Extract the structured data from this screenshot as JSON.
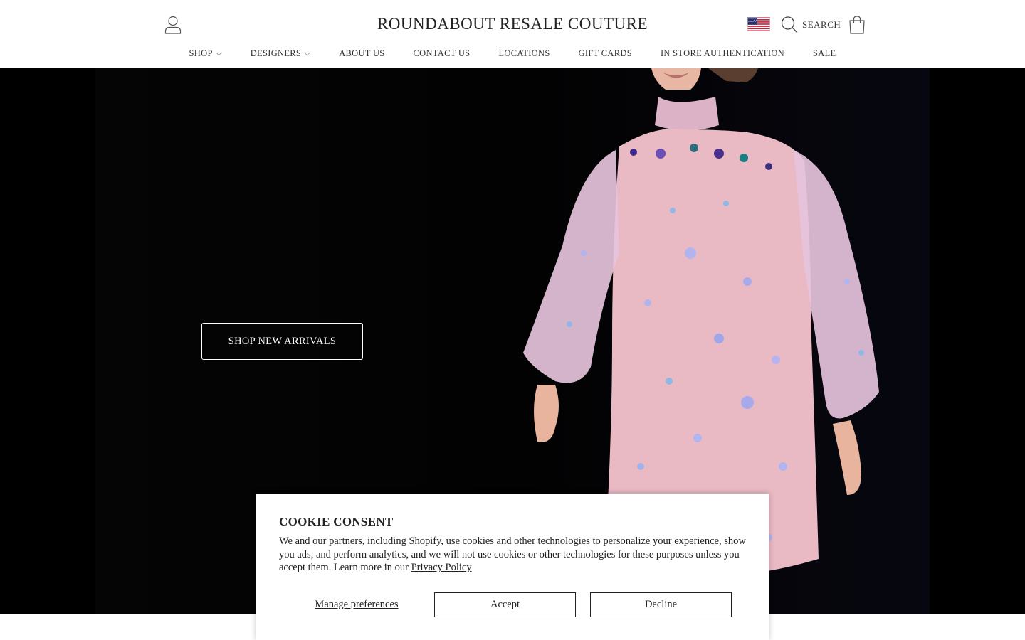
{
  "header": {
    "logo": "ROUNDABOUT RESALE COUTURE",
    "search_label": "SEARCH"
  },
  "nav": {
    "items": [
      {
        "label": "SHOP",
        "dropdown": true
      },
      {
        "label": "DESIGNERS",
        "dropdown": true
      },
      {
        "label": "ABOUT US",
        "dropdown": false
      },
      {
        "label": "CONTACT US",
        "dropdown": false
      },
      {
        "label": "LOCATIONS",
        "dropdown": false
      },
      {
        "label": "GIFT CARDS",
        "dropdown": false
      },
      {
        "label": "IN STORE AUTHENTICATION",
        "dropdown": false
      },
      {
        "label": "SALE",
        "dropdown": false
      }
    ]
  },
  "hero": {
    "cta_label": "SHOP NEW ARRIVALS"
  },
  "cookie": {
    "title": "COOKIE CONSENT",
    "body": "We and our partners, including Shopify, use cookies and other technologies to personalize your experience, show you ads, and perform analytics, and we will not use cookies or other technologies for these purposes unless you accept them. Learn more in our ",
    "link_label": "Privacy Policy",
    "manage_label": "Manage preferences",
    "accept_label": "Accept",
    "decline_label": "Decline"
  },
  "icons": {
    "account": "user-icon",
    "flag": "us-flag-icon",
    "search": "search-icon",
    "cart": "shopping-bag-icon",
    "dropdown": "chevron-down-icon"
  },
  "colors": {
    "text": "#222222",
    "hero_bg": "#000000",
    "dress": "#e9b9c4"
  }
}
